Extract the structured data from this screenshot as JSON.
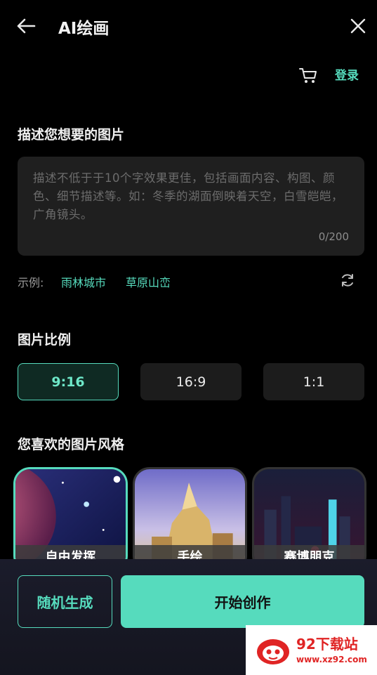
{
  "header": {
    "title": "AI绘画",
    "back_icon": "arrow-left-icon",
    "close_icon": "close-icon"
  },
  "top_actions": {
    "cart_icon": "cart-icon",
    "login_label": "登录"
  },
  "describe": {
    "title": "描述您想要的图片",
    "placeholder": "描述不低于于10个字效果更佳，包括画面内容、构图、颜色、细节描述等。如：冬季的湖面倒映着天空，白雪皑皑，广角镜头。",
    "value": "",
    "char_count": "0/200"
  },
  "examples": {
    "label": "示例:",
    "items": [
      "雨林城市",
      "草原山峦"
    ],
    "refresh_icon": "refresh-icon"
  },
  "ratio": {
    "title": "图片比例",
    "options": [
      "9:16",
      "16:9",
      "1:1"
    ],
    "selected": "9:16"
  },
  "style": {
    "title": "您喜欢的图片风格",
    "cards": [
      {
        "label": "自由发挥",
        "selected": true
      },
      {
        "label": "手绘",
        "selected": false
      },
      {
        "label": "赛博朋克",
        "selected": false
      }
    ]
  },
  "actions": {
    "random_label": "随机生成",
    "start_label": "开始创作"
  },
  "watermark": {
    "name": "92下载站",
    "url": "www.xz92.com"
  },
  "colors": {
    "accent": "#56dbbd",
    "background": "#000000",
    "input_bg": "#1f1f1f"
  }
}
